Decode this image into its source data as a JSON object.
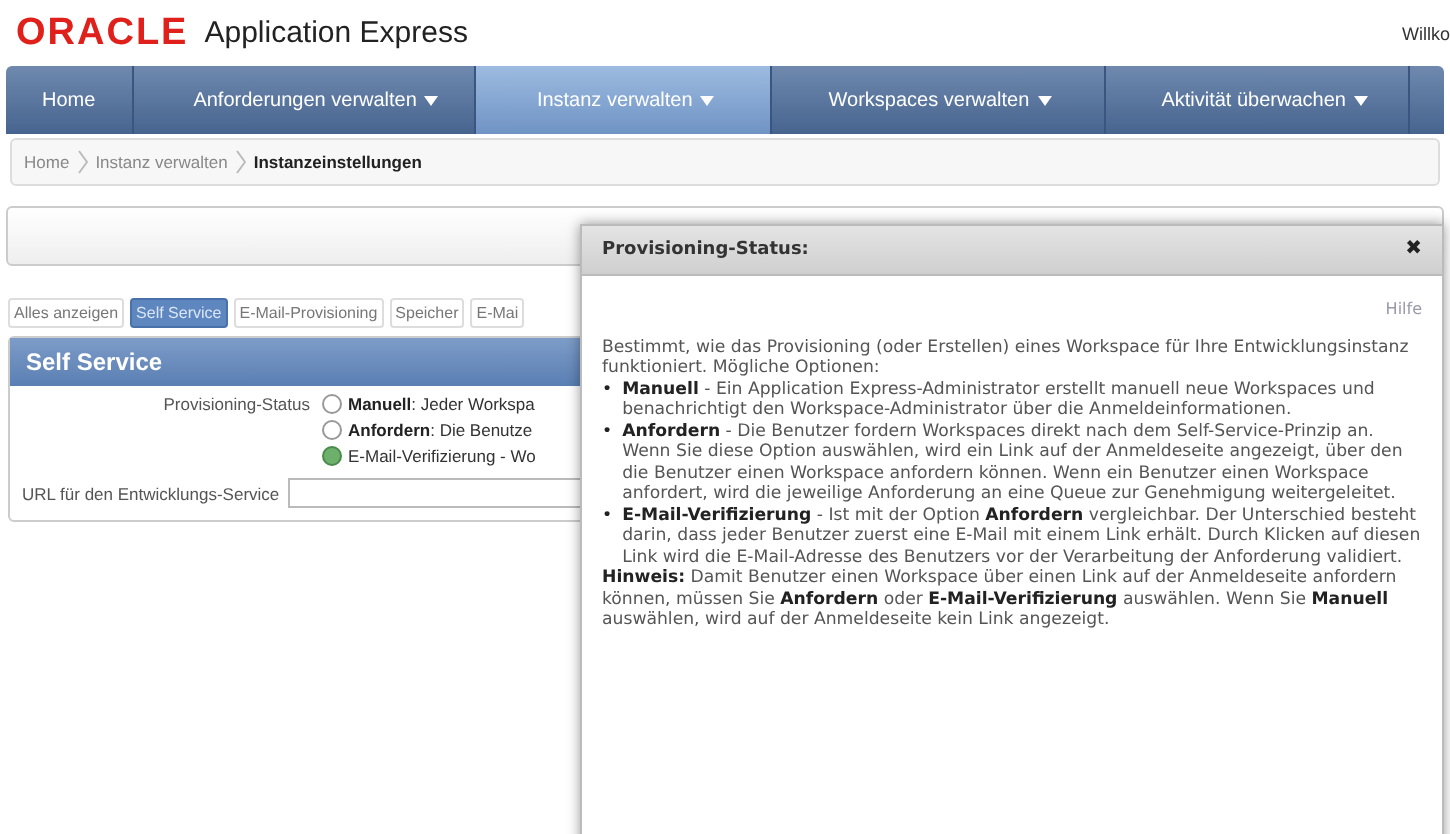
{
  "header": {
    "logo": "ORACLE",
    "product": "Application Express",
    "user": "Willko"
  },
  "nav": [
    {
      "label": "Home",
      "selected": false,
      "menu": false
    },
    {
      "label": "Anforderungen verwalten",
      "selected": false,
      "menu": true
    },
    {
      "label": "Instanz verwalten",
      "selected": true,
      "menu": true
    },
    {
      "label": "Workspaces verwalten",
      "selected": false,
      "menu": true
    },
    {
      "label": "Aktivität überwachen",
      "selected": false,
      "menu": true
    }
  ],
  "breadcrumb": [
    {
      "label": "Home",
      "current": false
    },
    {
      "label": "Instanz verwalten",
      "current": false
    },
    {
      "label": "Instanzeinstellungen",
      "current": true
    }
  ],
  "region_tabs": [
    {
      "label": "Alles anzeigen",
      "selected": false
    },
    {
      "label": "Self Service",
      "selected": true
    },
    {
      "label": "E-Mail-Provisioning",
      "selected": false
    },
    {
      "label": "Speicher",
      "selected": false
    },
    {
      "label": "E-Mai",
      "selected": false
    }
  ],
  "region": {
    "title": "Self Service",
    "provisioning_label": "Provisioning-Status",
    "options": [
      {
        "label": "**Manuell**: Jeder Workspa",
        "selected": false
      },
      {
        "label": "**Anfordern**: Die Benutze",
        "selected": false
      },
      {
        "label": "E-Mail-Verifizierung - Wo",
        "selected": true
      }
    ],
    "url_label": "URL für den Entwicklungs-Service"
  },
  "dialog": {
    "title": "Provisioning-Status:",
    "close": "✖",
    "help_link": "Hilfe",
    "intro": "Bestimmt, wie das Provisioning (oder Erstellen) eines Workspace für Ihre Entwicklungsinstanz funktioniert. Mögliche Optionen:",
    "bullet": "•",
    "items": [
      "**Manuell** - Ein Application Express-Administrator erstellt manuell neue Workspaces und benachrichtigt den Workspace-Administrator über die Anmeldeinformationen.",
      "**Anfordern** - Die Benutzer fordern Workspaces direkt nach dem Self-Service-Prinzip an. Wenn Sie diese Option auswählen, wird ein Link auf der Anmeldeseite angezeigt, über den die Benutzer einen Workspace anfordern können. Wenn ein Benutzer einen Workspace anfordert, wird die jeweilige Anforderung an eine Queue zur Genehmigung weitergeleitet.",
      "**E-Mail-Verifizierung** - Ist mit der Option **Anfordern** vergleichbar. Der Unterschied besteht darin, dass jeder Benutzer zuerst eine E-Mail mit einem Link erhält. Durch Klicken auf diesen Link wird die E-Mail-Adresse des Benutzers vor der Verarbeitung der Anforderung validiert."
    ],
    "note": "**Hinweis:** Damit Benutzer einen Workspace über einen Link auf der Anmeldeseite anfordern können, müssen Sie **Anfordern** oder **E-Mail-Verifizierung** auswählen. Wenn Sie **Manuell** auswählen, wird auf der Anmeldeseite kein Link angezeigt."
  }
}
